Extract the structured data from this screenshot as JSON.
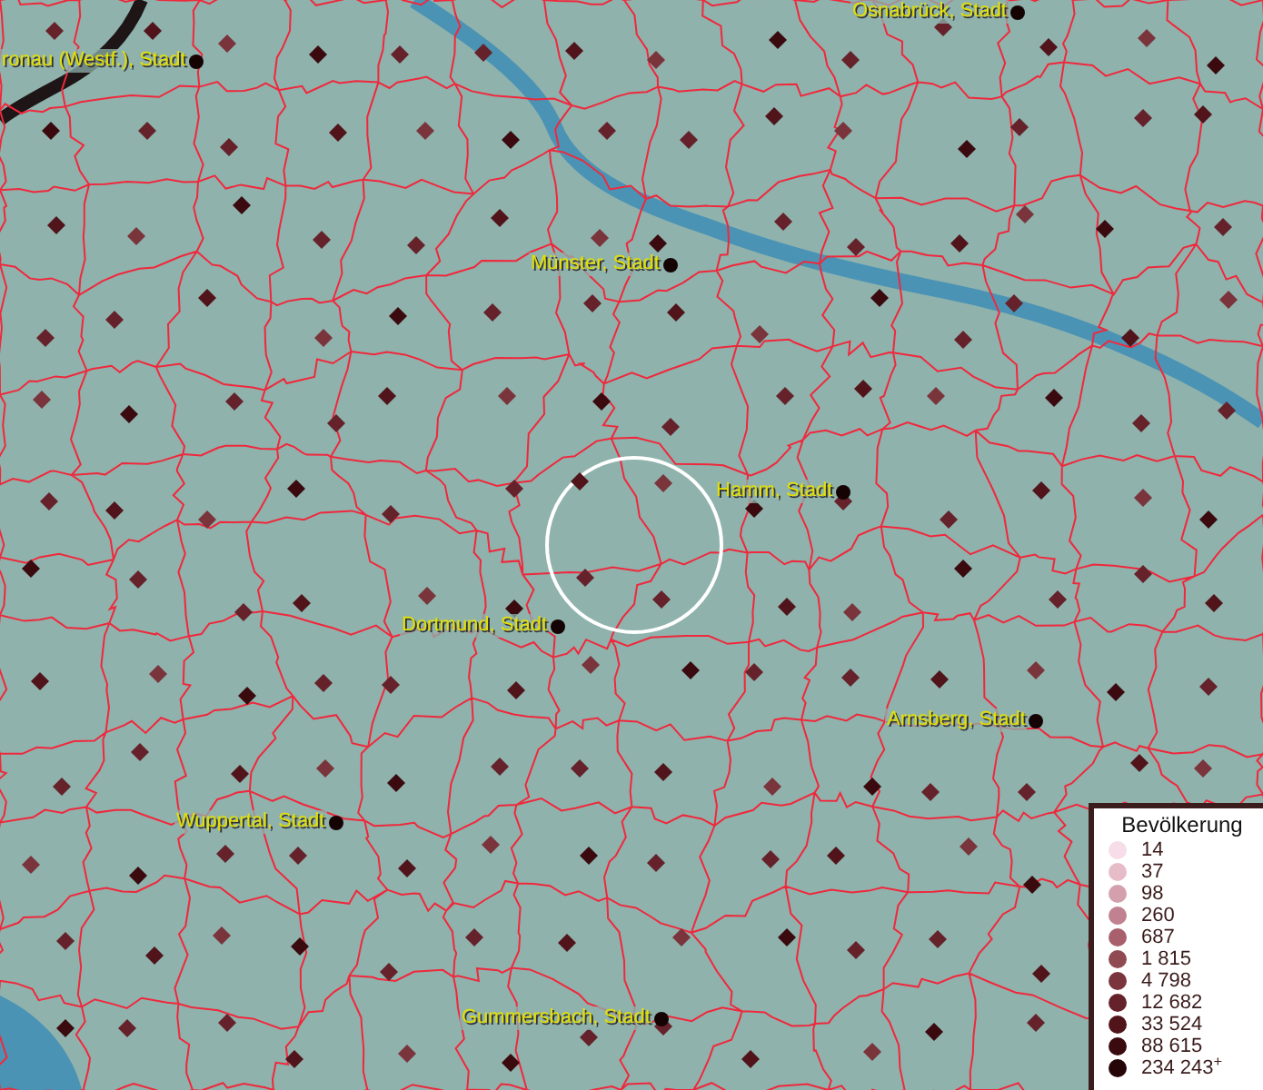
{
  "map": {
    "places": [
      {
        "label": "ronau (Westf.), Stadt"
      },
      {
        "label": "Osnabrück, Stadt"
      },
      {
        "label": "Münster, Stadt"
      },
      {
        "label": "Hamm, Stadt"
      },
      {
        "label": "Dortmund, Stadt"
      },
      {
        "label": "Arnsberg, Stadt"
      },
      {
        "label": "Wuppertal, Stadt"
      },
      {
        "label": "Gummersbach, Stadt"
      }
    ]
  },
  "legend": {
    "title": "Bevölkerung",
    "items": [
      {
        "label": "14",
        "color": "#f6dde8"
      },
      {
        "label": "37",
        "color": "#e5bcc8"
      },
      {
        "label": "98",
        "color": "#d4a0ad"
      },
      {
        "label": "260",
        "color": "#c08290"
      },
      {
        "label": "687",
        "color": "#a8616c"
      },
      {
        "label": "1 815",
        "color": "#904a52"
      },
      {
        "label": "4 798",
        "color": "#7a343b"
      },
      {
        "label": "12 682",
        "color": "#65222a"
      },
      {
        "label": "33 524",
        "color": "#50141a"
      },
      {
        "label": "88 615",
        "color": "#3a0a0f"
      },
      {
        "label": "234 243$^{+}$",
        "color": "#260508"
      }
    ]
  }
}
